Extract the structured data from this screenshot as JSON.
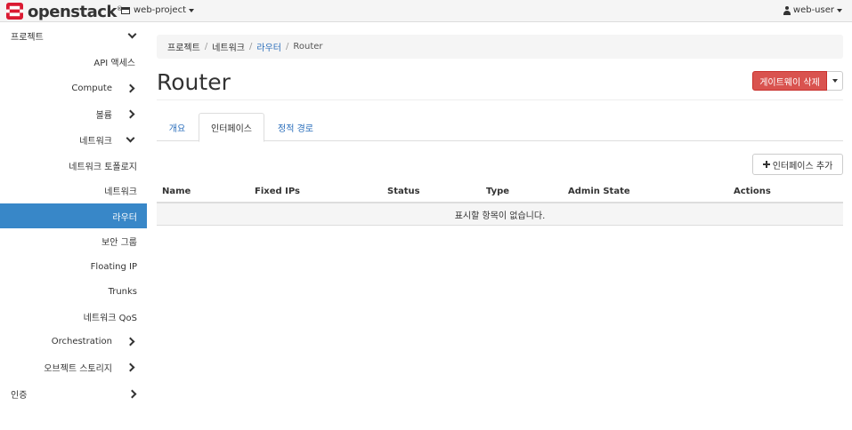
{
  "topbar": {
    "logo_text": "openstack",
    "logo_reg": "®",
    "project": "web-project",
    "user": "web-user"
  },
  "sidebar": {
    "project": "프로젝트",
    "api_access": "API 액세스",
    "compute": "Compute",
    "volume": "볼륨",
    "network": "네트워크",
    "network_topology": "네트워크 토폴로지",
    "networks": "네트워크",
    "routers": "라우터",
    "security_groups": "보안 그룹",
    "floating_ip": "Floating IP",
    "trunks": "Trunks",
    "network_qos": "네트워크 QoS",
    "orchestration": "Orchestration",
    "object_storage": "오브젝트 스토리지",
    "identity": "인증"
  },
  "breadcrumb": [
    "프로젝트",
    "네트워크",
    "라우터",
    "Router"
  ],
  "page": {
    "title": "Router",
    "delete_gateway": "게이트웨이 삭제"
  },
  "tabs": [
    "개요",
    "인터페이스",
    "정적 경로"
  ],
  "add_interface": "인터페이스 추가",
  "table": {
    "headers": [
      "Name",
      "Fixed IPs",
      "Status",
      "Type",
      "Admin State",
      "Actions"
    ],
    "empty": "표시할 항목이 없습니다."
  },
  "colors": {
    "accent": "#3887c8",
    "danger": "#d9534f",
    "logo_red": "#da1a32",
    "link": "#2a6ebb"
  }
}
